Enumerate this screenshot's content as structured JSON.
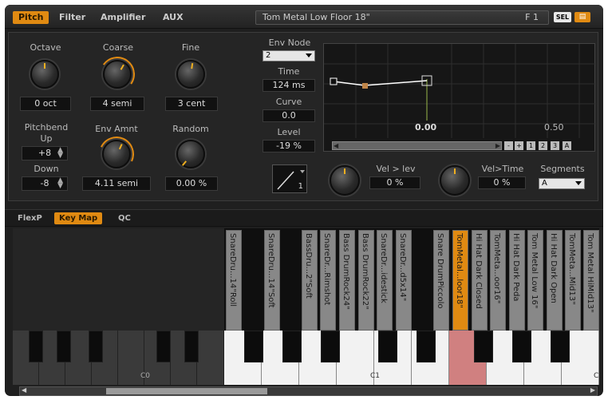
{
  "tabs": [
    "Pitch",
    "Filter",
    "Amplifier",
    "AUX"
  ],
  "preset": {
    "name": "Tom Metal Low Floor 18\"",
    "slot": "F 1"
  },
  "sel_label": "SEL",
  "knobs": {
    "octave": {
      "label": "Octave",
      "value": "0 oct"
    },
    "coarse": {
      "label": "Coarse",
      "value": "4 semi"
    },
    "fine": {
      "label": "Fine",
      "value": "3 cent"
    },
    "env_amnt": {
      "label": "Env Amnt",
      "value": "4.11 semi"
    },
    "random": {
      "label": "Random",
      "value": "0.00 %"
    }
  },
  "pitchbend": {
    "label_line1": "Pitchbend",
    "label_line2": "Up",
    "up": "+8",
    "down_label": "Down",
    "down": "-8"
  },
  "env": {
    "node_label": "Env Node",
    "node": "2",
    "time_label": "Time",
    "time": "124 ms",
    "curve_label": "Curve",
    "curve": "0.0",
    "level_label": "Level",
    "level": "-19 %",
    "axis_0": "0.00",
    "axis_1": "0.50"
  },
  "graph_buttons": [
    "-",
    "+",
    "1",
    "2",
    "3",
    "A"
  ],
  "vel_lev": {
    "label": "Vel > lev",
    "value": "0 %"
  },
  "vel_time": {
    "label": "Vel>Time",
    "value": "0 %"
  },
  "segments": {
    "label": "Segments",
    "value": "A"
  },
  "shape_num": "1",
  "subtabs": [
    "FlexP",
    "Key Map",
    "QC"
  ],
  "samples": [
    "SnareDru...14\"Roll",
    "SnareDru...14\"Soft",
    "BassDru...2\"Soft",
    "SnareDr...Rimshot",
    "Bass DrumRock24\"",
    "Bass DrumRock22\"",
    "SnareDr...idestick",
    "SnareDr...d5x14\"",
    "Snare DrumPiccolo",
    "TomMetal...loor18\"",
    "Hi Hat Dark Closed",
    "TomMeta...oor16\"",
    "Hi Hat Dark Peda",
    "Tom Metal Low 16\"",
    "Hi Hat Dark Open",
    "TomMeta...Mid13\"",
    "Tom Metal HiMid13\""
  ],
  "key_labels": {
    "c0": "C0",
    "c1": "C1",
    "c2": "C"
  },
  "colors": {
    "accent": "#e08a12",
    "selected_key": "#d08080"
  }
}
